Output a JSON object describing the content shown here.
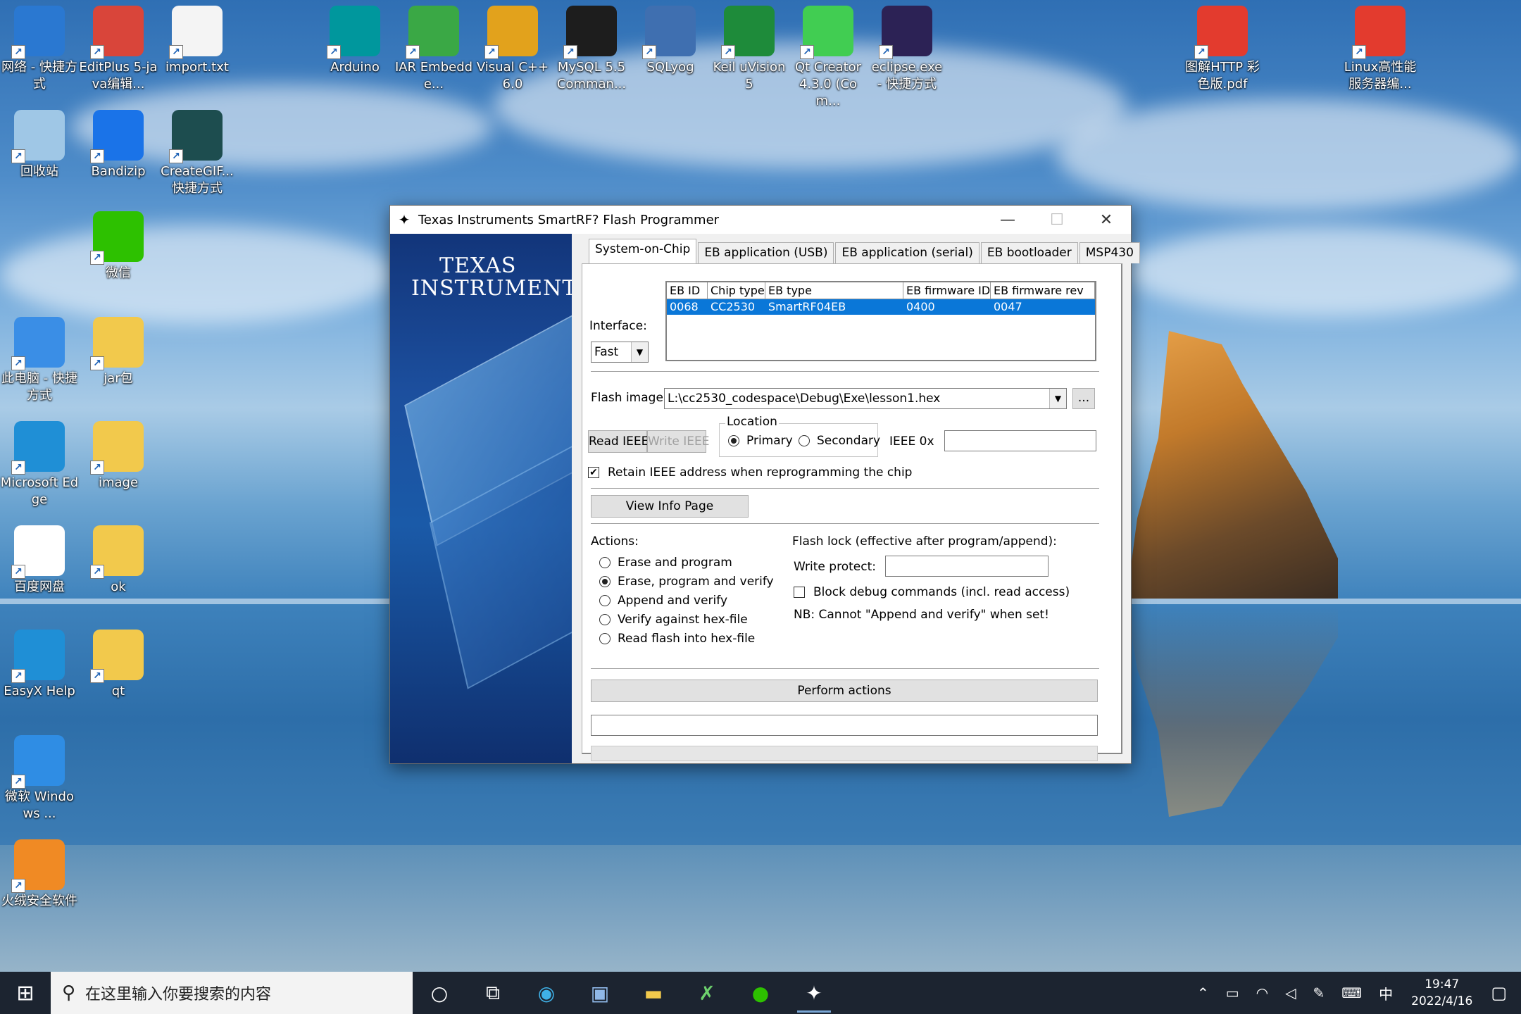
{
  "desktop": {
    "icons": [
      {
        "label": "网络 - 快捷方式",
        "icon": "network-icon",
        "color": "#2a78d1"
      },
      {
        "label": "EditPlus 5-java编辑...",
        "icon": "editplus-icon",
        "color": "#d9453a"
      },
      {
        "label": "import.txt",
        "icon": "text-file-icon",
        "color": "#f4f4f4"
      },
      {
        "label": "Arduino",
        "icon": "arduino-icon",
        "color": "#00979d"
      },
      {
        "label": "IAR Embedde...",
        "icon": "iar-icon",
        "color": "#3aa845"
      },
      {
        "label": "Visual C++ 6.0",
        "icon": "visual-cpp-icon",
        "color": "#e2a21c"
      },
      {
        "label": "MySQL 5.5 Comman...",
        "icon": "mysql-icon",
        "color": "#1d1d1d"
      },
      {
        "label": "SQLyog",
        "icon": "sqlyog-icon",
        "color": "#3f6fb0"
      },
      {
        "label": "Keil uVision5",
        "icon": "keil-icon",
        "color": "#1e8b3a"
      },
      {
        "label": "Qt Creator 4.3.0 (Com...",
        "icon": "qt-icon",
        "color": "#41cd52"
      },
      {
        "label": "eclipse.exe - 快捷方式",
        "icon": "eclipse-icon",
        "color": "#2c2255"
      },
      {
        "label": "图解HTTP 彩色版.pdf",
        "icon": "pdf-icon",
        "color": "#e33b2e"
      },
      {
        "label": "Linux高性能服务器编...",
        "icon": "pdf-icon",
        "color": "#e33b2e"
      },
      {
        "label": "回收站",
        "icon": "recycle-bin-icon",
        "color": "#9fc7e6"
      },
      {
        "label": "Bandizip",
        "icon": "bandizip-icon",
        "color": "#1a73e8"
      },
      {
        "label": "CreateGIF... 快捷方式",
        "icon": "gif-icon",
        "color": "#1d4d4f"
      },
      {
        "label": "微信",
        "icon": "wechat-icon",
        "color": "#2dc100"
      },
      {
        "label": "此电脑 - 快捷方式",
        "icon": "computer-icon",
        "color": "#3a8ee6"
      },
      {
        "label": "jar包",
        "icon": "folder-icon",
        "color": "#f2c94c"
      },
      {
        "label": "Microsoft Edge",
        "icon": "edge-icon",
        "color": "#1f8fd6"
      },
      {
        "label": "image",
        "icon": "folder-icon",
        "color": "#f2c94c"
      },
      {
        "label": "百度网盘",
        "icon": "baidu-netdisk-icon",
        "color": "#ffffff"
      },
      {
        "label": "ok",
        "icon": "folder-icon",
        "color": "#f2c94c"
      },
      {
        "label": "EasyX Help",
        "icon": "edge-icon",
        "color": "#1f8fd6"
      },
      {
        "label": "qt",
        "icon": "folder-icon",
        "color": "#f2c94c"
      },
      {
        "label": "微软 Windows ...",
        "icon": "windows-security-icon",
        "color": "#2f8de4"
      },
      {
        "label": "火绒安全软件",
        "icon": "huorong-icon",
        "color": "#f08a24"
      }
    ]
  },
  "window": {
    "title": "Texas Instruments SmartRF? Flash Programmer",
    "logo_line1": "TEXAS",
    "logo_line2": "INSTRUMENTS",
    "tabs": [
      "System-on-Chip",
      "EB application (USB)",
      "EB application (serial)",
      "EB bootloader",
      "MSP430"
    ],
    "interface_label": "Interface:",
    "interface_value": "Fast",
    "table": {
      "headers": [
        "EB ID",
        "Chip type",
        "EB type",
        "EB firmware ID",
        "EB firmware rev"
      ],
      "row": [
        "0068",
        "CC2530",
        "SmartRF04EB",
        "0400",
        "0047"
      ]
    },
    "flash_image_label": "Flash image:",
    "flash_image_value": "L:\\cc2530_codespace\\Debug\\Exe\\lesson1.hex",
    "browse_label": "...",
    "read_ieee": "Read IEEE",
    "write_ieee": "Write IEEE",
    "location_label": "Location",
    "primary_label": "Primary",
    "secondary_label": "Secondary",
    "ieee_label": "IEEE  0x",
    "ieee_value": "",
    "retain_label": "Retain IEEE address when reprogramming the chip",
    "view_info_page": "View Info Page",
    "actions_label": "Actions:",
    "actions": [
      "Erase and program",
      "Erase, program and verify",
      "Append and verify",
      "Verify against hex-file",
      "Read flash into hex-file"
    ],
    "selected_action": 1,
    "flash_lock_label": "Flash lock (effective after program/append):",
    "write_protect_label": "Write protect:",
    "write_protect_value": "",
    "block_debug_label": "Block debug commands (incl. read access)",
    "nb_label": "NB: Cannot \"Append and verify\" when set!",
    "perform_actions": "Perform actions",
    "status_text": ""
  },
  "taskbar": {
    "search_placeholder": "在这里输入你要搜索的内容",
    "ime": "中",
    "time": "19:47",
    "date": "2022/4/16"
  }
}
